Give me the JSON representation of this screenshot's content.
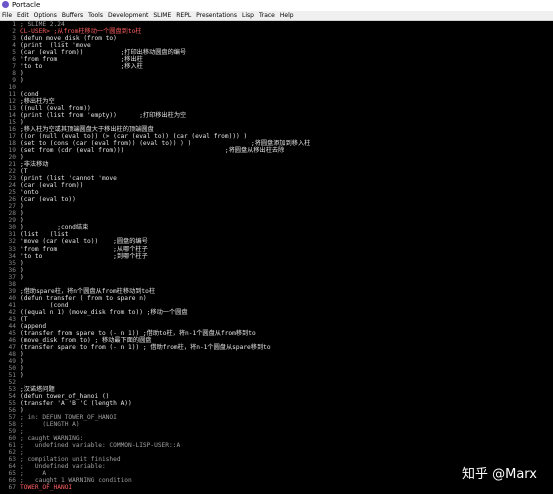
{
  "window": {
    "title": "Portacle"
  },
  "menu": [
    "File",
    "Edit",
    "Options",
    "Buffers",
    "Tools",
    "Development",
    "SLIME",
    "REPL",
    "Presentations",
    "Lisp",
    "Trace",
    "Help"
  ],
  "watermark": "知乎 @Marx",
  "colors": {
    "background": "#000000",
    "text": "#e6e6e6",
    "prompt": "#ff5f5f",
    "comment": "#a0a0a0",
    "line_number": "#8a8a8a"
  },
  "lines": [
    {
      "n": "1",
      "t": "; SLIME 2.24",
      "c": "comment"
    },
    {
      "n": "2",
      "t": "CL-USER> ;从from柱移动一个圆盘到to柱",
      "c": "prompt"
    },
    {
      "n": "3",
      "t": "(defun move_disk (from to)",
      "c": "default"
    },
    {
      "n": "4",
      "t": "(print  (list 'move",
      "c": "default"
    },
    {
      "n": "5",
      "t": "(car (eval from))          ;打印出移动圆盘的编号",
      "c": "default"
    },
    {
      "n": "6",
      "t": "'from from                 ;移出柱",
      "c": "default"
    },
    {
      "n": "7",
      "t": "'to to                     ;移入柱",
      "c": "default"
    },
    {
      "n": "8",
      "t": ")",
      "c": "default"
    },
    {
      "n": "9",
      "t": ")",
      "c": "default"
    },
    {
      "n": "10",
      "t": "",
      "c": "default"
    },
    {
      "n": "11",
      "t": "(cond",
      "c": "default"
    },
    {
      "n": "12",
      "t": ";移出柱为空",
      "c": "default"
    },
    {
      "n": "13",
      "t": "((null (eval from))",
      "c": "default"
    },
    {
      "n": "14",
      "t": "(print (list from 'empty))      ;打印移出柱为空",
      "c": "default"
    },
    {
      "n": "15",
      "t": ")",
      "c": "default"
    },
    {
      "n": "16",
      "t": ";移入柱为空或其顶端圆盘大于移出柱的顶端圆盘",
      "c": "default"
    },
    {
      "n": "17",
      "t": "((or (null (eval to)) (> (car (eval to)) (car (eval from))) )",
      "c": "default"
    },
    {
      "n": "18",
      "t": "(set to (cons (car (eval from)) (eval to)) ) )                ;将圆盘添加到移入柱",
      "c": "default"
    },
    {
      "n": "19",
      "t": "(set from (cdr (eval from)))                           ;将圆盘从移出柱去除",
      "c": "default"
    },
    {
      "n": "20",
      "t": ")",
      "c": "default"
    },
    {
      "n": "21",
      "t": ";非法移动",
      "c": "default"
    },
    {
      "n": "22",
      "t": "(T",
      "c": "default"
    },
    {
      "n": "23",
      "t": "(print (list 'cannot 'move",
      "c": "default"
    },
    {
      "n": "24",
      "t": "(car (eval from))",
      "c": "default"
    },
    {
      "n": "25",
      "t": "'onto",
      "c": "default"
    },
    {
      "n": "26",
      "t": "(car (eval to))",
      "c": "default"
    },
    {
      "n": "27",
      "t": ")",
      "c": "default"
    },
    {
      "n": "28",
      "t": ")",
      "c": "default"
    },
    {
      "n": "29",
      "t": ")",
      "c": "default"
    },
    {
      "n": "30",
      "t": ")         ;cond结束",
      "c": "default"
    },
    {
      "n": "31",
      "t": "(list   (list",
      "c": "default"
    },
    {
      "n": "32",
      "t": "'move (car (eval to))    ;圆盘的编号",
      "c": "default"
    },
    {
      "n": "33",
      "t": "'from from               ;从哪个柱子",
      "c": "default"
    },
    {
      "n": "34",
      "t": "'to to                   ;到哪个柱子",
      "c": "default"
    },
    {
      "n": "35",
      "t": ")",
      "c": "default"
    },
    {
      "n": "36",
      "t": ")",
      "c": "default"
    },
    {
      "n": "37",
      "t": ")",
      "c": "default"
    },
    {
      "n": "38",
      "t": "",
      "c": "default"
    },
    {
      "n": "39",
      "t": ";借助spare柱，将n个圆盘从from柱移动到to柱",
      "c": "default"
    },
    {
      "n": "40",
      "t": "(defun transfer ( from to spare n)",
      "c": "default"
    },
    {
      "n": "41",
      "t": "        (cond",
      "c": "default"
    },
    {
      "n": "42",
      "t": "((equal n 1) (move_disk from to)) ;移动一个圆盘",
      "c": "default"
    },
    {
      "n": "43",
      "t": "(T",
      "c": "default"
    },
    {
      "n": "44",
      "t": "(append",
      "c": "default"
    },
    {
      "n": "45",
      "t": "(transfer from spare to (- n 1)) ;借助to柱，将n-1个圆盘从from移到to",
      "c": "default"
    },
    {
      "n": "46",
      "t": "(move_disk from to) ; 移动最下面的圆盘",
      "c": "default"
    },
    {
      "n": "47",
      "t": "(transfer spare to from (- n 1)) ; 借助from柱，将n-1个圆盘从spare移到to",
      "c": "default"
    },
    {
      "n": "48",
      "t": ")",
      "c": "default"
    },
    {
      "n": "49",
      "t": ")",
      "c": "default"
    },
    {
      "n": "50",
      "t": ")",
      "c": "default"
    },
    {
      "n": "51",
      "t": ")",
      "c": "default"
    },
    {
      "n": "52",
      "t": "",
      "c": "default"
    },
    {
      "n": "53",
      "t": ";汉诺塔问题",
      "c": "default"
    },
    {
      "n": "54",
      "t": "(defun tower_of_hanoi ()",
      "c": "default"
    },
    {
      "n": "55",
      "t": "(transfer 'A 'B 'C (length A))",
      "c": "default"
    },
    {
      "n": "56",
      "t": ")",
      "c": "default"
    },
    {
      "n": "57",
      "t": "; in: DEFUN TOWER_OF_HANOI",
      "c": "comment"
    },
    {
      "n": "58",
      "t": ";     (LENGTH A)",
      "c": "comment"
    },
    {
      "n": "59",
      "t": ";",
      "c": "comment"
    },
    {
      "n": "60",
      "t": "; caught WARNING:",
      "c": "comment"
    },
    {
      "n": "61",
      "t": ";   undefined variable: COMMON-LISP-USER::A",
      "c": "comment"
    },
    {
      "n": "62",
      "t": ";",
      "c": "comment"
    },
    {
      "n": "63",
      "t": "; compilation unit finished",
      "c": "comment"
    },
    {
      "n": "64",
      "t": ";   Undefined variable:",
      "c": "comment"
    },
    {
      "n": "65",
      "t": ";     A",
      "c": "comment"
    },
    {
      "n": "66",
      "t": ";   caught 1 WARNING condition",
      "c": "comment"
    },
    {
      "n": "67",
      "t": "TOWER_OF_HANOI",
      "c": "prompt"
    }
  ]
}
